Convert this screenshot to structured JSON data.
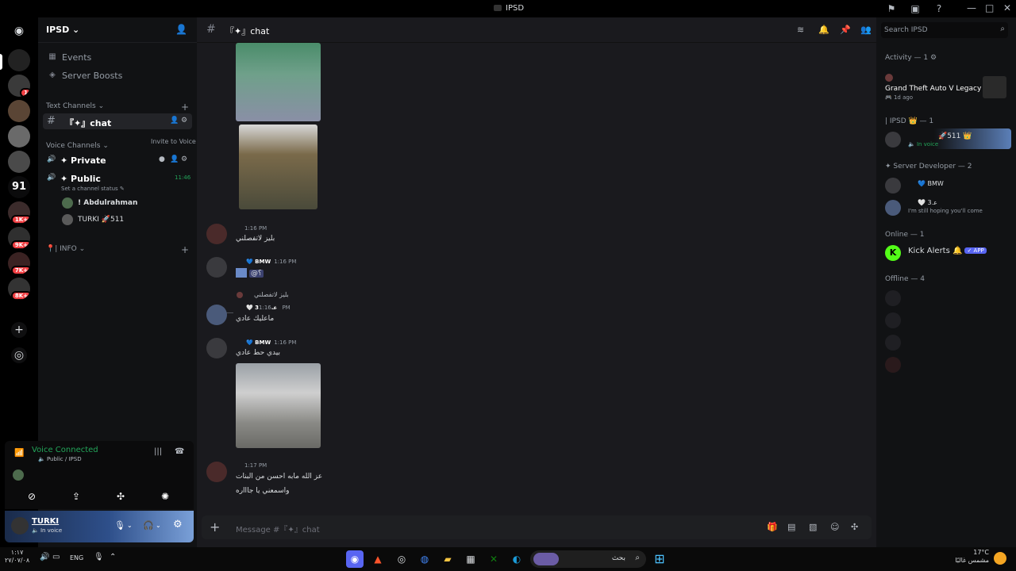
{
  "window": {
    "title": "IPSD"
  },
  "rail": {
    "badges": [
      "1",
      "1K+",
      "9K+",
      "7K+",
      "8K+"
    ],
    "number_server": "91"
  },
  "sidebar": {
    "server_name": "IPSD",
    "nav": [
      {
        "label": "Events",
        "icon": "calendar-icon"
      },
      {
        "label": "Server Boosts",
        "icon": "boost-icon"
      }
    ],
    "text_category": "Text Channels",
    "active_channel": "『✦』chat",
    "voice_category": "Voice Channels",
    "tooltip": "Invite to Voice",
    "voice_channels": [
      {
        "name": "✦ Private"
      },
      {
        "name": "✦ Public"
      }
    ],
    "voice_status_placeholder": "Set a channel status",
    "voice_timer": "11:46",
    "voice_users": [
      {
        "name": "! Abdulrahman"
      },
      {
        "name": "TURKI 🚀511"
      }
    ],
    "info_category": "📍| INFO"
  },
  "voice_panel": {
    "title": "Voice Connected",
    "subtitle": "🔈 Public / IPSD"
  },
  "user_panel": {
    "username": "TURKI",
    "status": "🔈 In voice"
  },
  "chat": {
    "channel_title": "『✦』chat",
    "messages": [
      {
        "time": "1:16 PM",
        "text": "بليز لاتفصلني"
      },
      {
        "name": "💙 BMW",
        "time": "1:16 PM",
        "text": "@؟"
      },
      {
        "reply_to": "بليز لاتفصلني",
        "name": "🤍 ﻋ.3",
        "time": "1:16 PM",
        "text": "ماعليك عادي"
      },
      {
        "name": "💙 BMW",
        "time": "1:16 PM",
        "text": "بيدي حط عادي"
      },
      {
        "time": "1:17 PM",
        "text": "عز الله مابه احسن من البنات",
        "text2": "واسمعني يا جاااره"
      }
    ],
    "composer_placeholder": "Message #『✦』chat"
  },
  "members": {
    "search_placeholder": "Search IPSD",
    "activity_header": "Activity — 1 ⚙",
    "activity": {
      "game": "Grand Theft Auto V Legacy",
      "ago": "🎮 1d ago"
    },
    "ipsd_header": "| IPSD 👑 — 1",
    "ipsd_member": {
      "name": "🚀511 👑",
      "status": "🔈 In voice"
    },
    "dev_header": "✦ Server Developer — 2",
    "dev_members": [
      {
        "name": "💙 BMW",
        "status": ""
      },
      {
        "name": "🤍 ﻋ.3",
        "status": "I'm still hoping you'll come"
      }
    ],
    "online_header": "Online — 1",
    "online_member": {
      "name": "Kick Alerts 🔔",
      "tag": "✓ APP"
    },
    "offline_header": "Offline — 4"
  },
  "taskbar": {
    "time": "١:١٧",
    "date": "٢٧/٠٧/٠٨",
    "lang": "ENG",
    "search_text": "بحث",
    "weather_temp": "17°C",
    "weather_desc": "مشمس غالبًا"
  },
  "colors": {
    "accent": "#5865f2",
    "online": "#23a55a",
    "badge": "#f23f43"
  }
}
